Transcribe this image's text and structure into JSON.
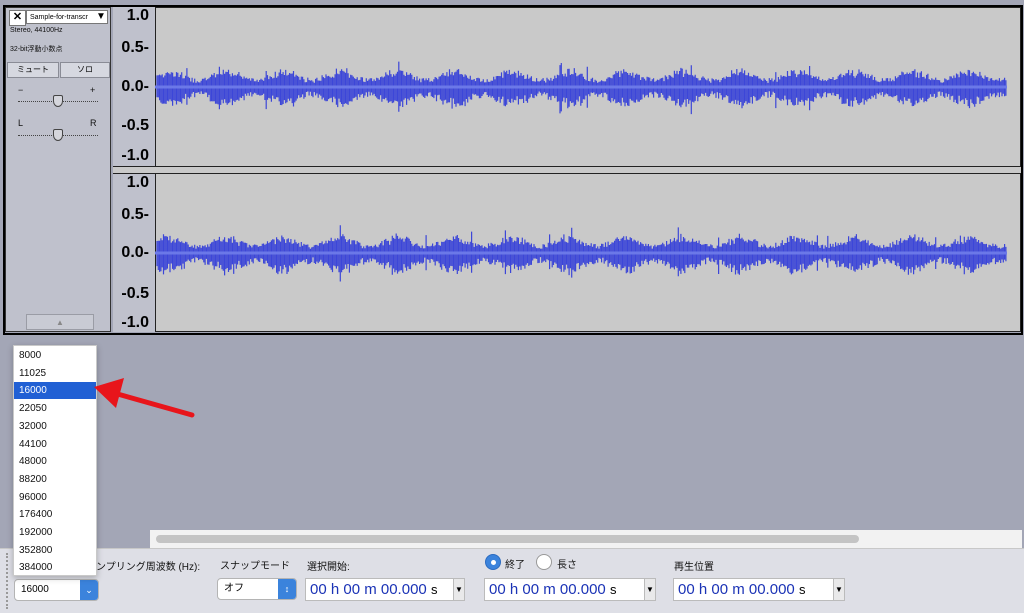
{
  "track": {
    "name": "Sample-for-transcr",
    "format_line1": "Stereo, 44100Hz",
    "format_line2": "32-bit浮動小数点",
    "mute_label": "ミュート",
    "solo_label": "ソロ",
    "gain_minus": "−",
    "gain_plus": "+",
    "pan_left": "L",
    "pan_right": "R",
    "close_symbol": "✕",
    "menu_symbol": "▼",
    "collapse_symbol": "▲"
  },
  "ruler": {
    "ticks": [
      "1.0",
      "0.5-",
      "0.0-",
      "-0.5",
      "-1.0"
    ]
  },
  "waveform": {
    "color": "#3c46d8",
    "center_color": "#6b78e8"
  },
  "toolbar": {
    "rate_label": "ンプリング周波数 (Hz):",
    "rate_value": "16000",
    "snap_label": "スナップモード",
    "snap_value": "オフ",
    "sel_start_label": "選択開始:",
    "end_label": "終了",
    "length_label": "長さ",
    "play_pos_label": "再生位置",
    "time_start": "00 h 00 m 00.000",
    "time_end": "00 h 00 m 00.000",
    "time_play": "00 h 00 m 00.000",
    "time_unit": "s"
  },
  "rate_options": [
    "8000",
    "11025",
    "16000",
    "22050",
    "32000",
    "44100",
    "48000",
    "88200",
    "96000",
    "176400",
    "192000",
    "352800",
    "384000"
  ],
  "selected_rate_index": 2,
  "annotation_color": "#e8151b"
}
